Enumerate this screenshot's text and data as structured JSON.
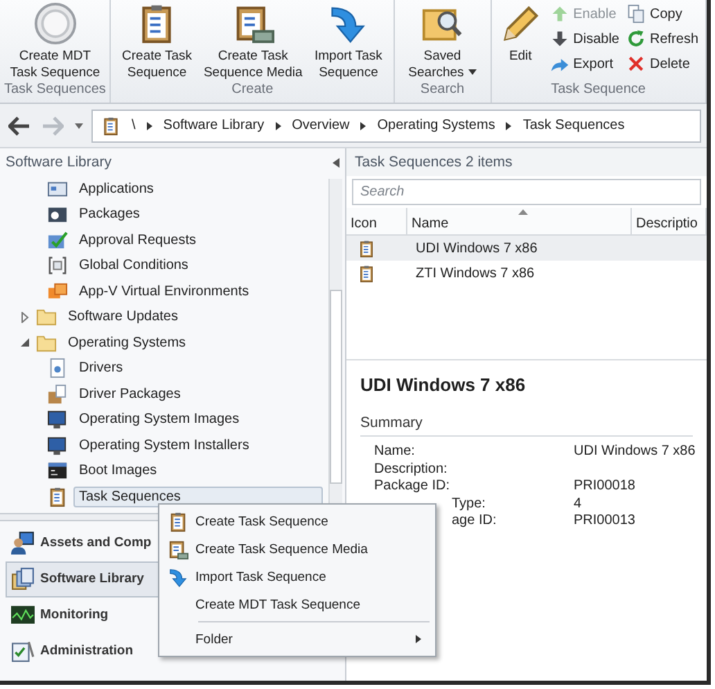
{
  "ribbon": {
    "groups": [
      {
        "label": "Task Sequences",
        "buttons": [
          {
            "kind": "large",
            "label": "Create MDT Task Sequence",
            "disabled": false
          }
        ]
      },
      {
        "label": "Create",
        "buttons": [
          {
            "kind": "large",
            "label": "Create Task Sequence",
            "disabled": false
          },
          {
            "kind": "large",
            "label": "Create Task Sequence Media",
            "disabled": false
          },
          {
            "kind": "large",
            "label": "Import Task Sequence",
            "disabled": false
          }
        ]
      },
      {
        "label": "Search",
        "buttons": [
          {
            "kind": "large",
            "label": "Saved Searches",
            "dropdown": true,
            "disabled": false
          }
        ]
      },
      {
        "label": "Task Sequence",
        "buttons": [
          {
            "kind": "large",
            "label": "Edit",
            "disabled": false
          },
          {
            "kind": "small",
            "label": "Enable",
            "disabled": true
          },
          {
            "kind": "small",
            "label": "Disable",
            "disabled": false
          },
          {
            "kind": "small",
            "label": "Export",
            "disabled": false
          },
          {
            "kind": "small",
            "label": "Copy",
            "disabled": false
          },
          {
            "kind": "small",
            "label": "Refresh",
            "disabled": false
          },
          {
            "kind": "small",
            "label": "Delete",
            "disabled": false
          }
        ]
      }
    ]
  },
  "address_bar": {
    "path": [
      "\\",
      "Software Library",
      "Overview",
      "Operating Systems",
      "Task Sequences"
    ]
  },
  "sidebar": {
    "title": "Software Library",
    "tree": [
      {
        "kind": "leaf",
        "label": "Applications",
        "selected": false
      },
      {
        "kind": "leaf",
        "label": "Packages",
        "selected": false
      },
      {
        "kind": "leaf",
        "label": "Approval Requests",
        "selected": false
      },
      {
        "kind": "leaf",
        "label": "Global Conditions",
        "selected": false
      },
      {
        "kind": "leaf",
        "label": "App-V Virtual Environments",
        "selected": false
      },
      {
        "kind": "folder",
        "label": "Software Updates",
        "selected": false,
        "expanded": false
      },
      {
        "kind": "folder",
        "label": "Operating Systems",
        "selected": false,
        "expanded": true,
        "children": [
          {
            "kind": "leaf",
            "label": "Drivers",
            "selected": false
          },
          {
            "kind": "leaf",
            "label": "Driver Packages",
            "selected": false
          },
          {
            "kind": "leaf",
            "label": "Operating System Images",
            "selected": false
          },
          {
            "kind": "leaf",
            "label": "Operating System Installers",
            "selected": false
          },
          {
            "kind": "leaf",
            "label": "Boot Images",
            "selected": false
          },
          {
            "kind": "leaf",
            "label": "Task Sequences",
            "selected": true
          }
        ]
      }
    ],
    "workspaces": [
      {
        "label": "Assets and Comp",
        "selected": false
      },
      {
        "label": "Software Library",
        "selected": true
      },
      {
        "label": "Monitoring",
        "selected": false
      },
      {
        "label": "Administration",
        "selected": false
      }
    ]
  },
  "list": {
    "title": "Task Sequences 2 items",
    "search": {
      "placeholder": "Search"
    },
    "columns": [
      {
        "label": "Icon"
      },
      {
        "label": "Name",
        "sorted": true
      },
      {
        "label": "Descriptio"
      }
    ],
    "rows": [
      {
        "name": "UDI Windows 7 x86",
        "selected": true
      },
      {
        "name": "ZTI Windows 7 x86",
        "selected": false
      }
    ]
  },
  "details": {
    "title": "UDI Windows 7 x86",
    "section": "Summary",
    "fields": [
      {
        "label": "Name:",
        "value": "UDI Windows 7 x86"
      },
      {
        "label": "Description:"
      },
      {
        "label": "Package ID:",
        "value": "PRI00018"
      },
      {
        "label": "Type:",
        "value": "4",
        "covered": true
      },
      {
        "label": "age ID:",
        "value": "PRI00013",
        "covered": true
      }
    ]
  },
  "context_menu": {
    "items": [
      {
        "label": "Create Task Sequence"
      },
      {
        "label": "Create Task Sequence Media"
      },
      {
        "label": "Import Task Sequence"
      },
      {
        "label": "Create MDT Task Sequence"
      },
      {
        "label": "Folder",
        "submenu": true,
        "separator_before": true
      }
    ]
  }
}
